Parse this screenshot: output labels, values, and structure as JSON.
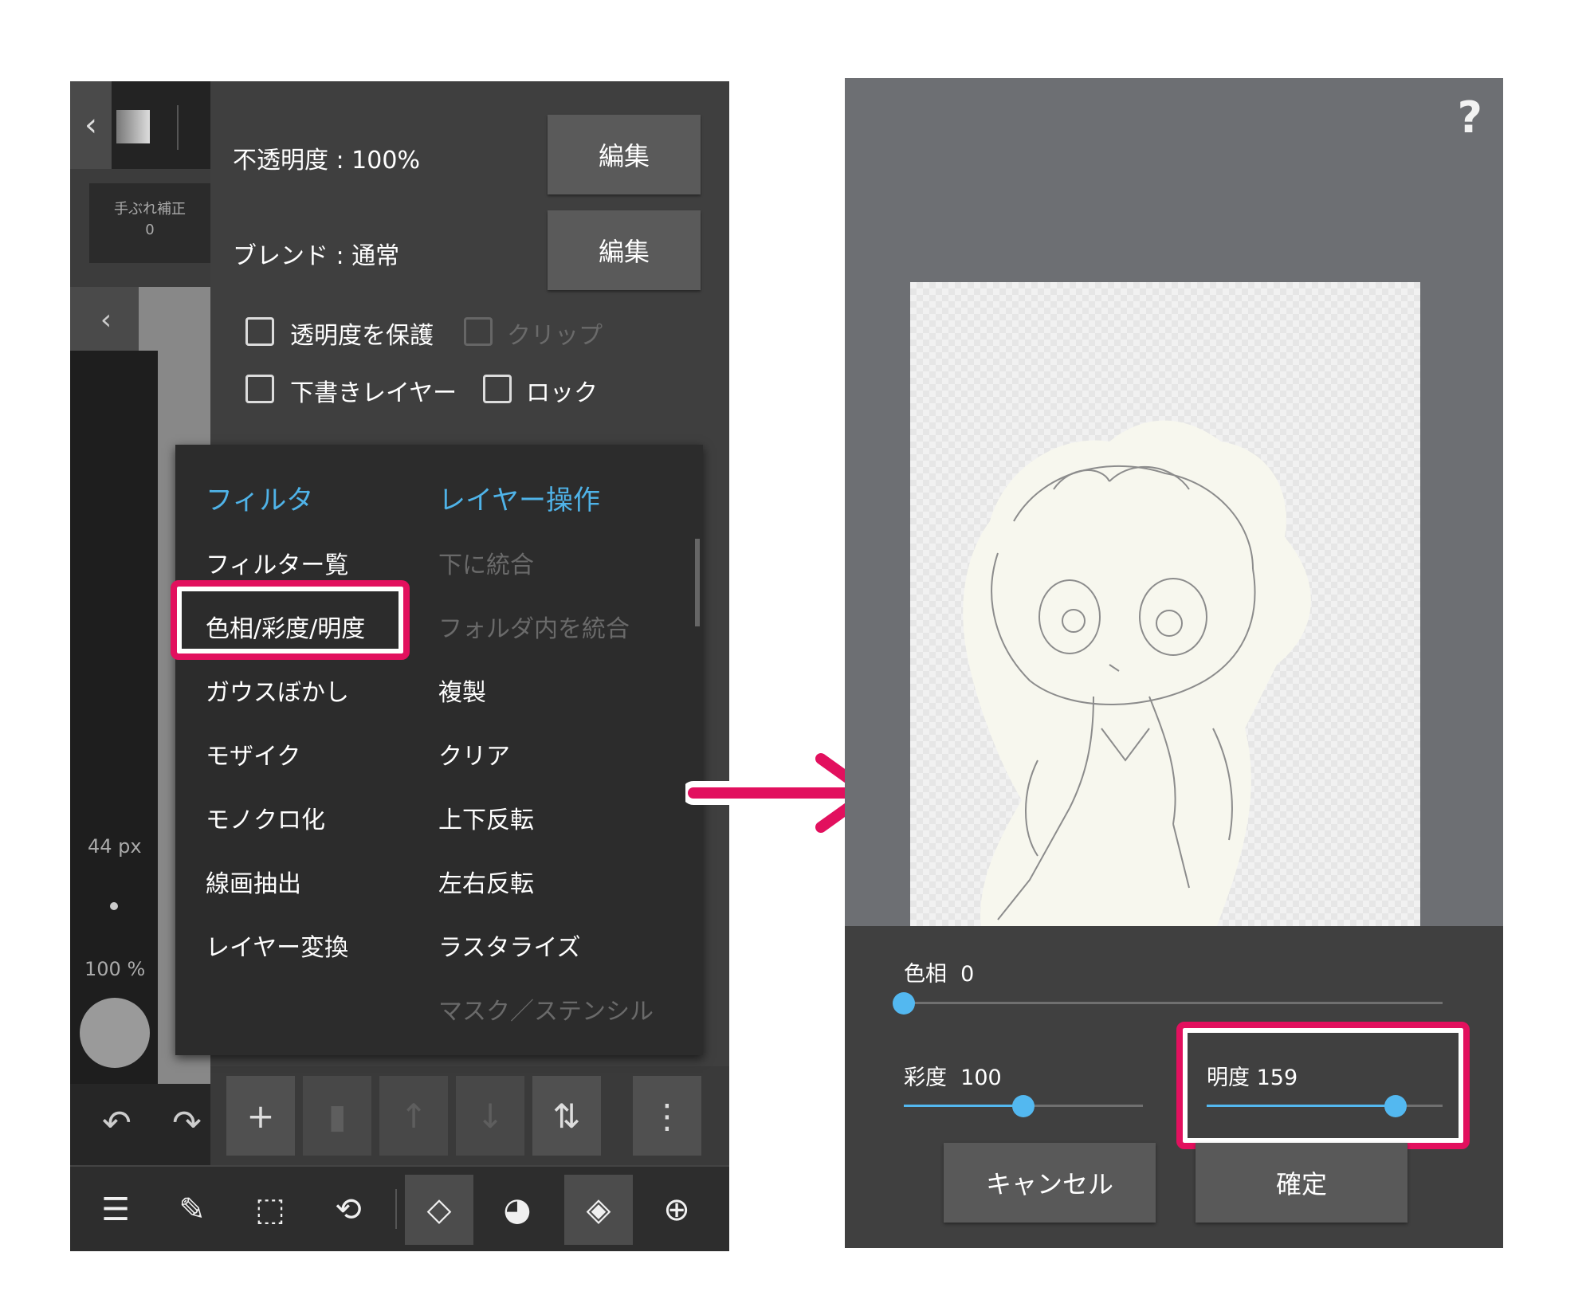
{
  "left_panel": {
    "stabilizer": {
      "label": "手ぶれ補正",
      "value": "0"
    },
    "brush_size": "44 px",
    "brush_opacity": "100 %",
    "layer_props": {
      "opacity_label": "不透明度 : 100%",
      "blend_label": "ブレンド : 通常",
      "edit_label": "編集",
      "checkboxes": [
        {
          "label": "透明度を保護",
          "enabled": true
        },
        {
          "label": "クリップ",
          "enabled": false
        },
        {
          "label": "下書きレイヤー",
          "enabled": true
        },
        {
          "label": "ロック",
          "enabled": true
        }
      ]
    },
    "menu": {
      "filter_header": "フィルタ",
      "layer_header": "レイヤー操作",
      "filter_items": [
        "フィルター覧",
        "色相/彩度/明度",
        "ガウスぼかし",
        "モザイク",
        "モノクロ化",
        "線画抽出",
        "レイヤー変換"
      ],
      "layer_items": [
        {
          "label": "下に統合",
          "enabled": false
        },
        {
          "label": "フォルダ内を統合",
          "enabled": false
        },
        {
          "label": "複製",
          "enabled": true
        },
        {
          "label": "クリア",
          "enabled": true
        },
        {
          "label": "上下反転",
          "enabled": true
        },
        {
          "label": "左右反転",
          "enabled": true
        },
        {
          "label": "ラスタライズ",
          "enabled": true
        },
        {
          "label": "マスク／ステンシル",
          "enabled": false
        }
      ]
    }
  },
  "right_panel": {
    "help": "?",
    "sliders": {
      "hue": {
        "label": "色相",
        "value": "0",
        "fraction": 0.0
      },
      "saturation": {
        "label": "彩度",
        "value": "100",
        "fraction": 0.5
      },
      "brightness": {
        "label": "明度",
        "value": "159",
        "fraction": 0.8
      }
    },
    "cancel_label": "キャンセル",
    "confirm_label": "確定"
  },
  "colors": {
    "accent": "#53b8f0",
    "highlight": "#e2105e",
    "menu_header": "#4fb3e8"
  }
}
